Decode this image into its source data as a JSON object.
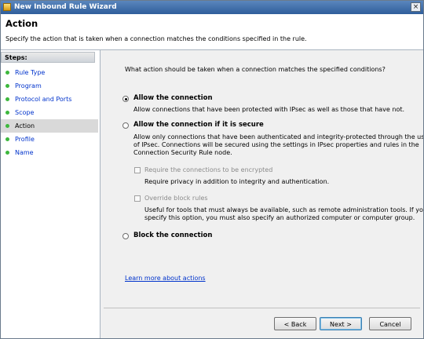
{
  "window": {
    "title": "New Inbound Rule Wizard",
    "close_glyph": "×"
  },
  "header": {
    "title": "Action",
    "description": "Specify the action that is taken when a connection matches the conditions specified in the rule."
  },
  "steps": {
    "title": "Steps:",
    "items": [
      {
        "label": "Rule Type"
      },
      {
        "label": "Program"
      },
      {
        "label": "Protocol and Ports"
      },
      {
        "label": "Scope"
      },
      {
        "label": "Action",
        "current": true
      },
      {
        "label": "Profile"
      },
      {
        "label": "Name"
      }
    ]
  },
  "content": {
    "question": "What action should be taken when a connection matches the specified conditions?",
    "allow": {
      "label": "Allow the connection",
      "description": "Allow connections that have been protected with IPsec as well as those that have not.",
      "selected": true
    },
    "allow_secure": {
      "label": "Allow the connection if it is secure",
      "description_lines": [
        "Allow only connections that have been authenticated and integrity-protected through the use",
        "of IPsec. Connections will be secured using the settings in IPsec properties and rules in the",
        "Connection Security Rule node."
      ],
      "selected": false
    },
    "require_encrypted": {
      "label": "Require the connections to be encrypted",
      "description": "Require privacy in addition to integrity and authentication.",
      "checked": false
    },
    "override_block": {
      "label": "Override block rules",
      "description_lines": [
        "Useful for tools that must always be available, such as remote administration tools.  If you",
        "specify this option, you must also specify an authorized computer or computer group."
      ],
      "checked": false
    },
    "block": {
      "label": "Block the connection",
      "selected": false
    },
    "learn_more": "Learn more about actions"
  },
  "buttons": {
    "back": "< Back",
    "next": "Next >",
    "cancel": "Cancel"
  },
  "colors": {
    "title_bar": "#3f6ea8",
    "link": "#0033cc",
    "step_dot": "#3db83d",
    "current_step": "#d9d9d9"
  }
}
